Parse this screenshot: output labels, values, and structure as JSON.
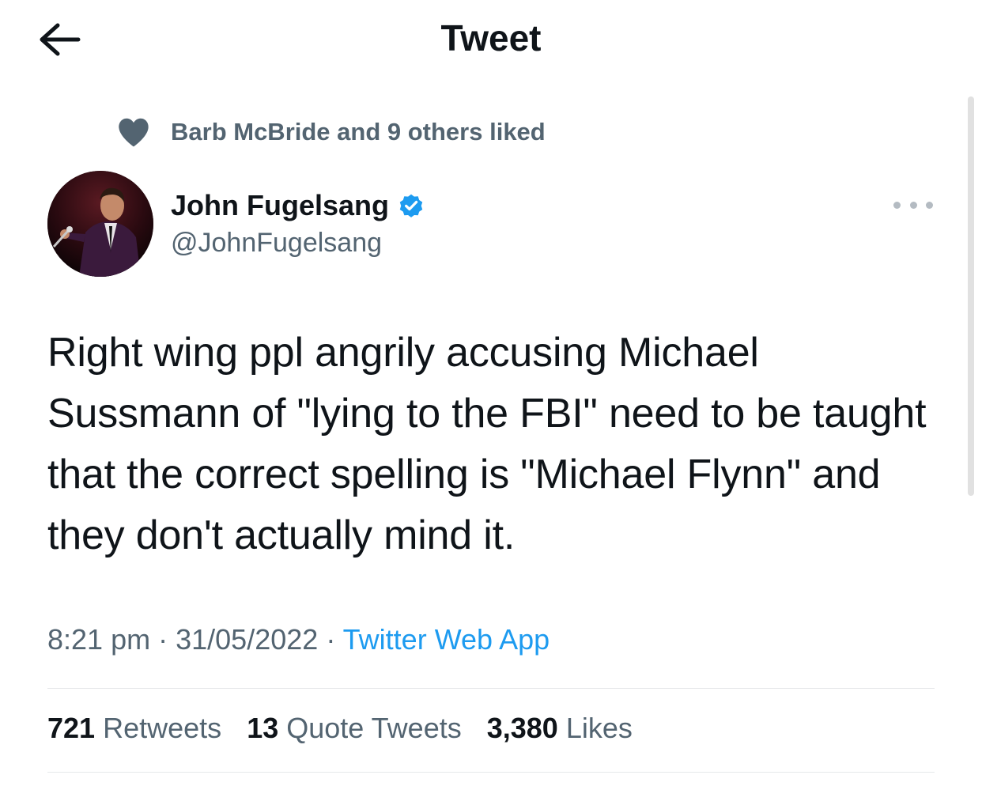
{
  "header": {
    "title": "Tweet",
    "back_icon": "arrow-left-icon"
  },
  "social_context": {
    "icon": "heart-icon",
    "text": "Barb McBride and 9 others liked"
  },
  "author": {
    "name": "John Fugelsang",
    "handle": "@JohnFugelsang",
    "verified": true,
    "verified_color": "#1d9bf0"
  },
  "tweet": {
    "text": "Right wing ppl angrily accusing Michael Sussmann of \"lying to the FBI\" need to be taught that the correct spelling is \"Michael Flynn\" and they don't actually mind it.",
    "time": "8:21 pm",
    "date": "31/05/2022",
    "separator": "·",
    "source": "Twitter Web App"
  },
  "stats": {
    "retweets_count": "721",
    "retweets_label": "Retweets",
    "quotes_count": "13",
    "quotes_label": "Quote Tweets",
    "likes_count": "3,380",
    "likes_label": "Likes"
  },
  "colors": {
    "accent": "#1d9bf0",
    "secondary_text": "#536471",
    "primary_text": "#0f1419"
  }
}
